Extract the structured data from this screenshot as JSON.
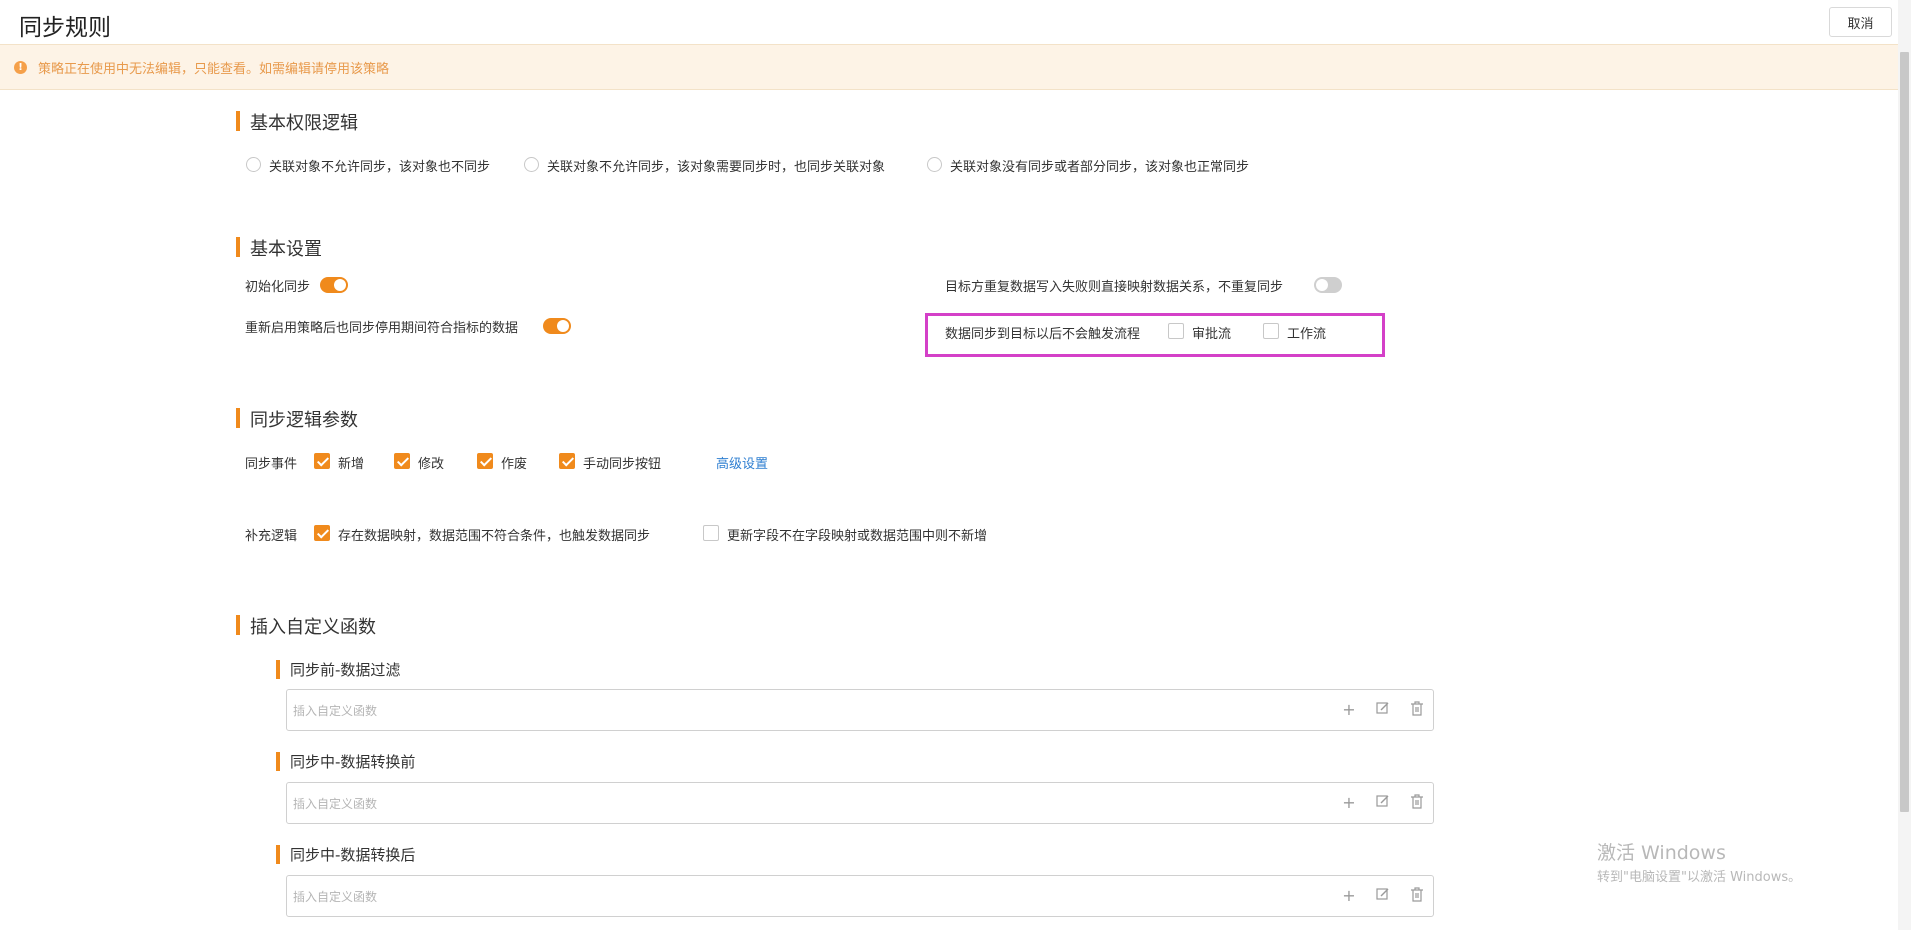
{
  "header": {
    "title": "同步规则",
    "cancel_label": "取消"
  },
  "banner": {
    "icon": "warning-icon",
    "text": "策略正在使用中无法编辑，只能查看。如需编辑请停用该策略"
  },
  "permission": {
    "title": "基本权限逻辑",
    "options": [
      {
        "label": "关联对象不允许同步，该对象也不同步",
        "selected": false
      },
      {
        "label": "关联对象不允许同步，该对象需要同步时，也同步关联对象",
        "selected": false
      },
      {
        "label": "关联对象没有同步或者部分同步，该对象也正常同步",
        "selected": false
      }
    ]
  },
  "basic_settings": {
    "title": "基本设置",
    "init_sync": {
      "label": "初始化同步",
      "on": true
    },
    "restart_sync": {
      "label": "重新启用策略后也同步停用期间符合指标的数据",
      "on": true
    },
    "dup_write": {
      "label": "目标方重复数据写入失败则直接映射数据关系，不重复同步",
      "on": false
    },
    "no_trigger": {
      "label": "数据同步到目标以后不会触发流程",
      "approval": "审批流",
      "workflow": "工作流"
    }
  },
  "sync_logic": {
    "title": "同步逻辑参数",
    "events_label": "同步事件",
    "events": [
      {
        "label": "新增",
        "checked": true
      },
      {
        "label": "修改",
        "checked": true
      },
      {
        "label": "作废",
        "checked": true
      },
      {
        "label": "手动同步按钮",
        "checked": true
      }
    ],
    "advanced_link": "高级设置",
    "supplement_label": "补充逻辑",
    "supplements": [
      {
        "label": "存在数据映射，数据范围不符合条件，也触发数据同步",
        "checked": true
      },
      {
        "label": "更新字段不在字段映射或数据范围中则不新增",
        "checked": false
      }
    ]
  },
  "custom_functions": {
    "title": "插入自定义函数",
    "groups": [
      {
        "title": "同步前-数据过滤",
        "placeholder": "插入自定义函数"
      },
      {
        "title": "同步中-数据转换前",
        "placeholder": "插入自定义函数"
      },
      {
        "title": "同步中-数据转换后",
        "placeholder": "插入自定义函数"
      }
    ]
  },
  "watermark": {
    "line1": "激活 Windows",
    "line2": "转到\"电脑设置\"以激活 Windows。"
  },
  "colors": {
    "accent": "#f08a1c",
    "highlight": "#d440c8",
    "link": "#2f7fd1",
    "banner_bg": "#fdf3e6"
  }
}
